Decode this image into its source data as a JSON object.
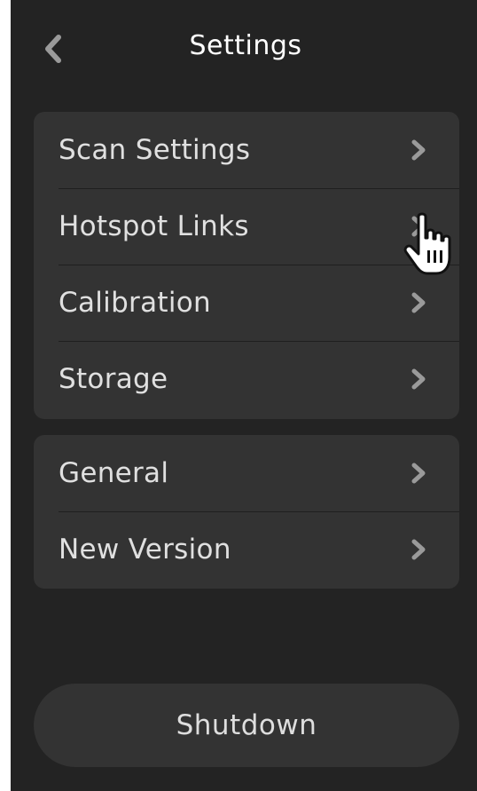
{
  "header": {
    "title": "Settings",
    "back_icon": "chevron-left-icon"
  },
  "groups": [
    {
      "items": [
        {
          "label": "Scan Settings",
          "icon": "chevron-right-icon"
        },
        {
          "label": "Hotspot Links",
          "icon": "chevron-right-icon"
        },
        {
          "label": "Calibration",
          "icon": "chevron-right-icon"
        },
        {
          "label": "Storage",
          "icon": "chevron-right-icon"
        }
      ]
    },
    {
      "items": [
        {
          "label": "General",
          "icon": "chevron-right-icon"
        },
        {
          "label": "New Version",
          "icon": "chevron-right-icon"
        }
      ]
    }
  ],
  "footer": {
    "shutdown_label": "Shutdown"
  },
  "pointer": {
    "icon": "hand-pointer-icon",
    "hovering": "Hotspot Links"
  },
  "colors": {
    "background": "#232323",
    "card": "#333333",
    "text": "#e0e0e0",
    "title": "#ffffff",
    "chevron": "#9a9a9a"
  }
}
